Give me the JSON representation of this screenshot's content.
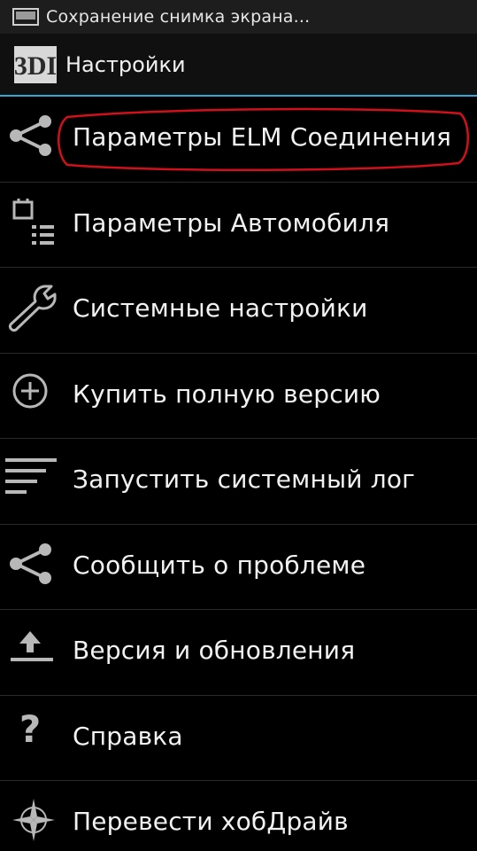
{
  "status_bar": {
    "notification_text": "Сохранение снимка экрана..."
  },
  "action_bar": {
    "logo_text": "3DI",
    "title": "Настройки"
  },
  "menu": {
    "items": [
      {
        "label": "Параметры ELM Соединения",
        "icon": "share-icon"
      },
      {
        "label": "Параметры Автомобиля",
        "icon": "car-settings-icon"
      },
      {
        "label": "Системные настройки",
        "icon": "wrench-icon"
      },
      {
        "label": "Купить полную версию",
        "icon": "plus-circle-icon"
      },
      {
        "label": "Запустить системный лог",
        "icon": "log-lines-icon"
      },
      {
        "label": "Сообщить о проблеме",
        "icon": "share-icon"
      },
      {
        "label": "Версия и обновления",
        "icon": "upload-icon"
      },
      {
        "label": "Справка",
        "icon": "question-icon"
      },
      {
        "label": "Перевести хобДрайв",
        "icon": "compass-icon"
      }
    ]
  },
  "colors": {
    "accent": "#33a6d6",
    "highlight_circle": "#d0101a",
    "icon": "#b8b8b8"
  }
}
